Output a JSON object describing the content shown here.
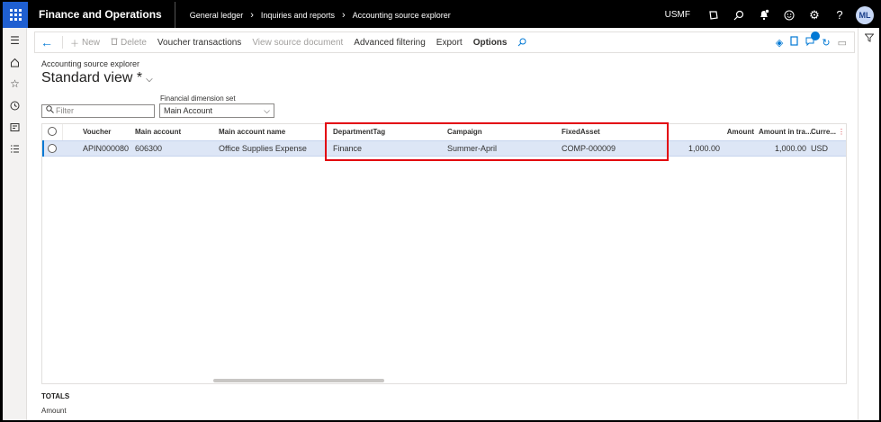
{
  "topbar": {
    "app_title": "Finance and Operations",
    "breadcrumbs": [
      "General ledger",
      "Inquiries and reports",
      "Accounting source explorer"
    ],
    "company": "USMF",
    "avatar_initials": "ML"
  },
  "action_pane": {
    "new": "New",
    "delete": "Delete",
    "voucher_transactions": "Voucher transactions",
    "view_source_document": "View source document",
    "advanced_filtering": "Advanced filtering",
    "export": "Export",
    "options": "Options",
    "notification_count": "0"
  },
  "page": {
    "caption": "Accounting source explorer",
    "title": "Standard view *"
  },
  "filters": {
    "filter_placeholder": "Filter",
    "dimension_set_label": "Financial dimension set",
    "dimension_set_value": "Main Account"
  },
  "grid": {
    "columns": {
      "voucher": "Voucher",
      "main_account": "Main account",
      "main_account_name": "Main account name",
      "department_tag": "DepartmentTag",
      "campaign": "Campaign",
      "fixed_asset": "FixedAsset",
      "amount": "Amount",
      "amount_in_tra": "Amount in tra...",
      "currency": "Curre..."
    },
    "rows": [
      {
        "voucher": "APIN000080",
        "main_account": "606300",
        "main_account_name": "Office Supplies Expense",
        "department_tag": "Finance",
        "campaign": "Summer-April",
        "fixed_asset": "COMP-000009",
        "amount": "1,000.00",
        "amount_in_tra": "1,000.00",
        "currency": "USD"
      }
    ]
  },
  "totals": {
    "heading": "TOTALS",
    "amount_label": "Amount"
  },
  "colors": {
    "topbar_bg": "#000000",
    "waffle_bg": "#1f5fd1",
    "selected_row_bg": "#dde6f6",
    "highlight_border": "#e3000f",
    "accent": "#0078d4"
  }
}
